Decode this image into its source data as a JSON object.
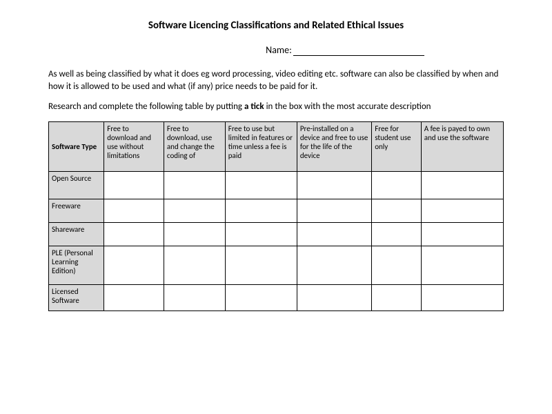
{
  "title": "Software Licencing Classifications and Related Ethical Issues",
  "name_label": "Name:",
  "para1_a": "As well as being classified by what it does eg word processing, video editing etc. software can also be classified by when and how it is allowed to be used and what (if any) price needs to be paid for it.",
  "para2_a": "Research and complete the following table by putting ",
  "para2_bold": "a tick",
  "para2_b": " in the box with the most accurate description",
  "table": {
    "corner": "Software Type",
    "cols": [
      "Free to download and use without limitations",
      "Free to download, use and change the coding of",
      "Free to use but limited in features or time unless a fee is paid",
      "Pre-installed on a device and free to use for the life of the device",
      "Free for student use only",
      "A fee is payed to own and use the software"
    ],
    "rows": [
      "Open Source",
      "Freeware",
      "Shareware",
      "PLE (Personal Learning Edition)",
      "Licensed Software"
    ]
  }
}
